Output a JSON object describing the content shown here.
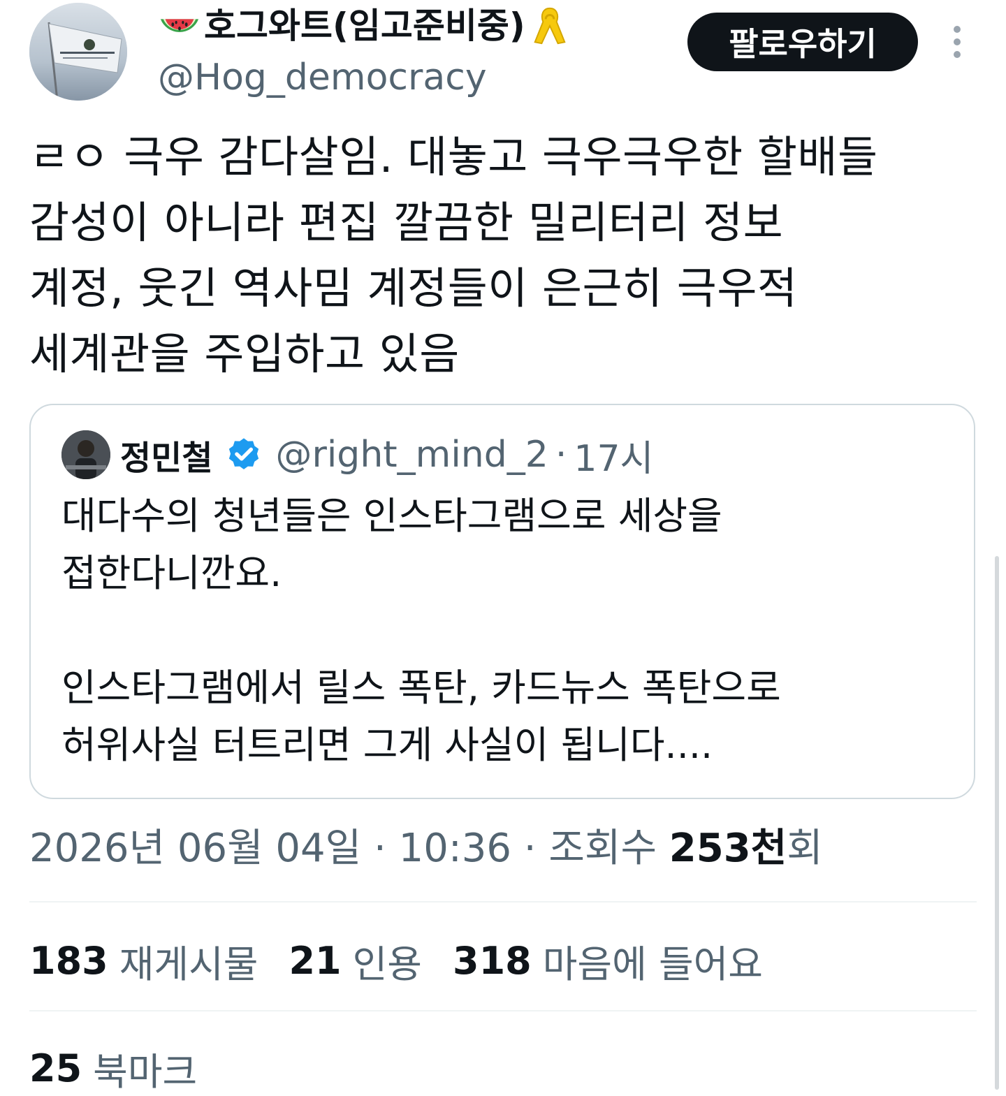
{
  "author": {
    "display_name": "호그와트(임고준비중)",
    "prefix_icon": "watermelon-icon",
    "suffix_icon": "yellow-ribbon-icon",
    "handle": "@Hog_democracy"
  },
  "header": {
    "follow_label": "팔로우하기",
    "more_icon": "more-vertical-icon"
  },
  "tweet": {
    "text": "ㄹㅇ 극우 감다살임. 대놓고 극우극우한 할배들\n감성이 아니라 편집 깔끔한 밀리터리 정보\n계정, 웃긴 역사밈 계정들이 은근히 극우적\n세계관을 주입하고 있음"
  },
  "quote": {
    "name": "정민철",
    "verified_icon": "verified-badge-icon",
    "handle": "@right_mind_2",
    "separator": "·",
    "time": "17시",
    "text": "대다수의 청년들은 인스타그램으로 세상을\n접한다니깐요.\n\n인스타그램에서 릴스 폭탄, 카드뉴스 폭탄으로\n허위사실 터트리면 그게 사실이 됩니다...."
  },
  "meta": {
    "date": "2026년 06월 04일",
    "sep1": " · ",
    "time": "10:36",
    "sep2": " · ",
    "views_label": "조회수 ",
    "views_count": "253천",
    "views_suffix": "회"
  },
  "stats": {
    "retweets_count": "183",
    "retweets_label": "재게시물",
    "quotes_count": "21",
    "quotes_label": "인용",
    "likes_count": "318",
    "likes_label": "마음에 들어요",
    "bookmarks_count": "25",
    "bookmarks_label": "북마크"
  },
  "colors": {
    "text_primary": "#0f1419",
    "text_secondary": "#536471",
    "border": "#cfd9de",
    "divider": "#eff3f4",
    "verified_blue": "#1d9bf0",
    "follow_bg": "#0f1419"
  }
}
